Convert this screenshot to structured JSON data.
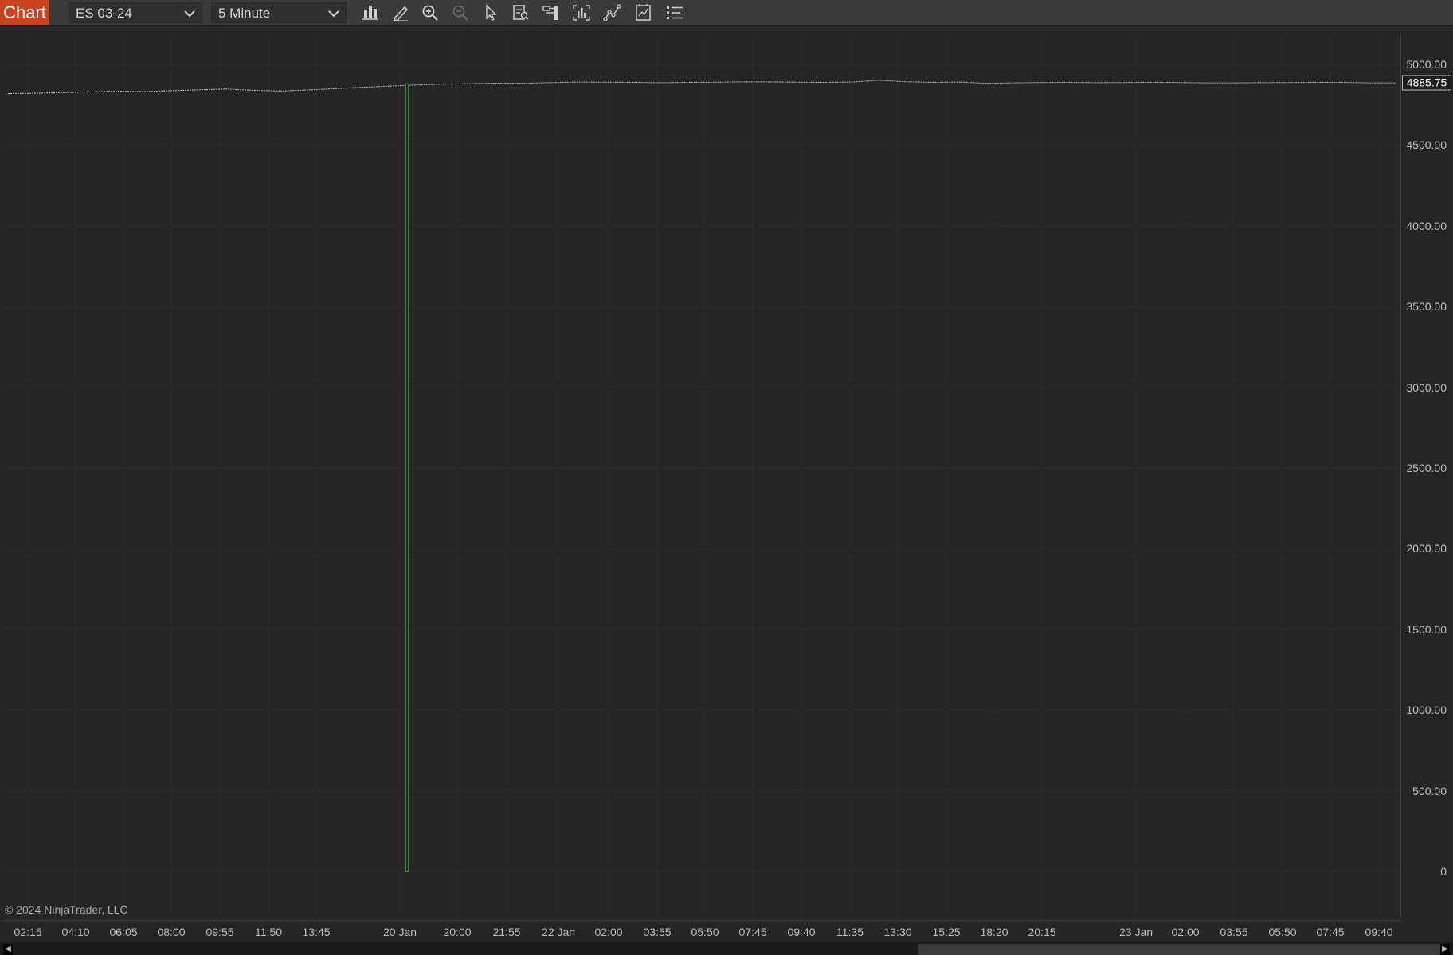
{
  "toolbar": {
    "chart_tab": "Chart",
    "instrument": "ES 03-24",
    "interval": "5 Minute",
    "tools": [
      "bar-type-icon",
      "drawing-pencil-icon",
      "zoom-in-icon",
      "zoom-out-icon",
      "cursor-pointer-icon",
      "data-box-icon",
      "chart-trader-icon",
      "indicators-icon",
      "strategies-icon",
      "templates-icon",
      "properties-list-icon"
    ]
  },
  "copyright": "© 2024 NinjaTrader, LLC",
  "colors": {
    "background": "#252525",
    "toolbar": "#3a3a3a",
    "chart_tab": "#c9431e",
    "spike_bar": "#7cc47c",
    "price_line": "#bdbdbd"
  },
  "chart_data": {
    "type": "line",
    "title": "",
    "instrument": "ES 03-24",
    "interval": "5 Minute",
    "ylim": [
      -300,
      5300
    ],
    "y_ticks": [
      "5000.00",
      "4500.00",
      "4000.00",
      "3500.00",
      "3000.00",
      "2500.00",
      "2000.00",
      "1500.00",
      "1000.00",
      "500.00",
      "0"
    ],
    "y_tick_values": [
      5000,
      4500,
      4000,
      3500,
      3000,
      2500,
      2000,
      1500,
      1000,
      500,
      0
    ],
    "last_price": 4885.75,
    "last_price_label": "4885.75",
    "x_ticks": [
      "02:15",
      "04:10",
      "06:05",
      "08:00",
      "09:55",
      "11:50",
      "13:45",
      "20 Jan",
      "20:00",
      "21:55",
      "22 Jan",
      "02:00",
      "03:55",
      "05:50",
      "07:45",
      "09:40",
      "11:35",
      "13:30",
      "15:25",
      "18:20",
      "20:15",
      "23 Jan",
      "02:00",
      "03:55",
      "05:50",
      "07:45",
      "09:40"
    ],
    "series": [
      {
        "values": [
          4820,
          4822,
          4826,
          4830,
          4835,
          4832,
          4838,
          4843,
          4848,
          4840,
          4836,
          4842,
          4850,
          4858,
          4866,
          4873,
          4878,
          4881,
          4884,
          4883,
          4888,
          4891,
          4890,
          4889,
          4887,
          4889,
          4890,
          4892,
          4892,
          4890,
          4889,
          4891,
          4902,
          4893,
          4889,
          4891,
          4883,
          4886,
          4888,
          4889,
          4887,
          4888,
          4889,
          4888,
          4886,
          4886,
          4887,
          4888,
          4889,
          4889,
          4886,
          4885.75
        ]
      }
    ],
    "spike_bar": {
      "x_label": "20 Jan",
      "high": 4880,
      "low": 0
    }
  }
}
